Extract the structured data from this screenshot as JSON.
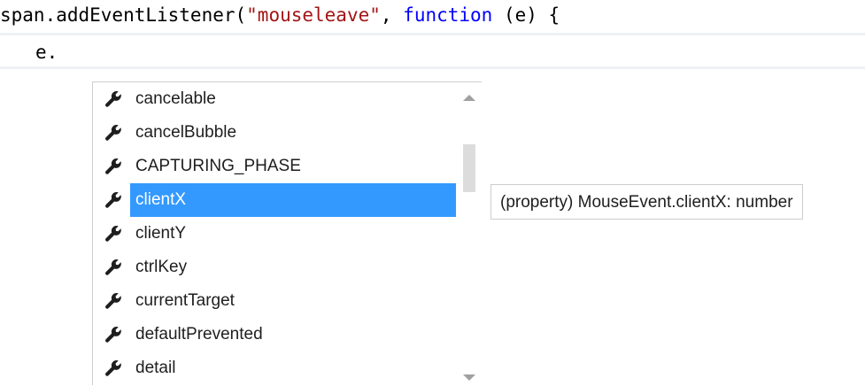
{
  "editor": {
    "line1": {
      "prefix": "span.addEventListener(",
      "string_literal": "\"mouseleave\"",
      "comma": ", ",
      "keyword": "function",
      "suffix": " (e) {"
    },
    "line2": {
      "text": "e."
    }
  },
  "completion": {
    "icon": "wrench-icon",
    "selected_index": 3,
    "items": [
      {
        "label": "cancelable"
      },
      {
        "label": "cancelBubble"
      },
      {
        "label": "CAPTURING_PHASE"
      },
      {
        "label": "clientX"
      },
      {
        "label": "clientY"
      },
      {
        "label": "ctrlKey"
      },
      {
        "label": "currentTarget"
      },
      {
        "label": "defaultPrevented"
      },
      {
        "label": "detail"
      }
    ]
  },
  "tooltip": {
    "text": "(property) MouseEvent.clientX: number"
  },
  "colors": {
    "selection": "#3399ff",
    "keyword": "#0000ff",
    "string": "#a31515"
  }
}
